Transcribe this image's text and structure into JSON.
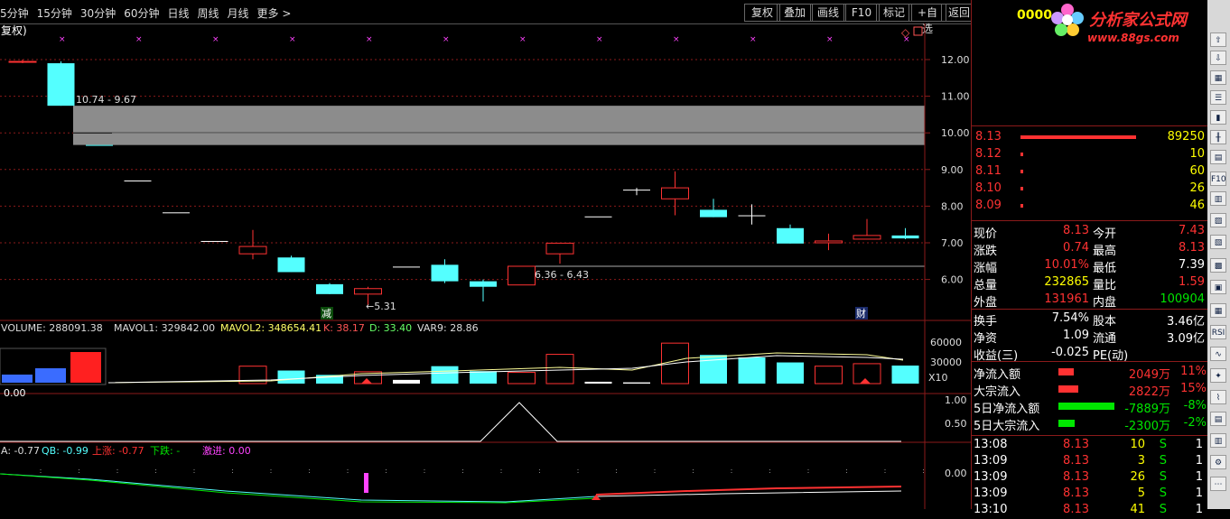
{
  "toolbar": {
    "periods": [
      "5分钟",
      "15分钟",
      "30分钟",
      "60分钟",
      "日线",
      "周线",
      "月线",
      "更多 >"
    ],
    "buttons": [
      "复权",
      "叠加",
      "画线",
      "F10",
      "标记",
      "+自选",
      "返回"
    ]
  },
  "main_chart": {
    "label": "复权)",
    "price_ticks": [
      "12.00",
      "11.00",
      "10.00",
      "9.00",
      "8.00",
      "7.00",
      "6.00"
    ],
    "gap_labels": [
      "10.74 - 9.67",
      "6.36 - 6.43"
    ],
    "low_label": "←5.31",
    "markers": [
      "减",
      "财"
    ],
    "candles": [
      {
        "o": 11.95,
        "h": 12.0,
        "l": 11.9,
        "c": 11.93,
        "col": "red"
      },
      {
        "o": 11.9,
        "h": 11.95,
        "l": 10.74,
        "c": 10.74,
        "col": "cyan"
      },
      {
        "o": 9.67,
        "h": 9.67,
        "l": 9.67,
        "c": 9.67,
        "col": "cyan"
      },
      {
        "o": 8.7,
        "h": 8.7,
        "l": 8.7,
        "c": 8.7,
        "col": "white"
      },
      {
        "o": 7.83,
        "h": 7.83,
        "l": 7.83,
        "c": 7.83,
        "col": "white"
      },
      {
        "o": 7.05,
        "h": 7.05,
        "l": 7.05,
        "c": 7.05,
        "col": "white"
      },
      {
        "o": 6.7,
        "h": 7.35,
        "l": 6.55,
        "c": 6.9,
        "col": "red"
      },
      {
        "o": 6.6,
        "h": 6.65,
        "l": 6.2,
        "c": 6.2,
        "col": "cyan"
      },
      {
        "o": 5.87,
        "h": 5.9,
        "l": 5.6,
        "c": 5.6,
        "col": "cyan"
      },
      {
        "o": 5.6,
        "h": 5.8,
        "l": 5.31,
        "c": 5.75,
        "col": "red"
      },
      {
        "o": 6.35,
        "h": 6.35,
        "l": 6.35,
        "c": 6.35,
        "col": "white"
      },
      {
        "o": 6.4,
        "h": 6.55,
        "l": 5.9,
        "c": 5.95,
        "col": "cyan"
      },
      {
        "o": 5.95,
        "h": 6.0,
        "l": 5.4,
        "c": 5.8,
        "col": "cyan"
      },
      {
        "o": 5.85,
        "h": 6.36,
        "l": 5.85,
        "c": 6.36,
        "col": "red"
      },
      {
        "o": 6.7,
        "h": 7.0,
        "l": 6.43,
        "c": 6.99,
        "col": "red"
      },
      {
        "o": 7.72,
        "h": 7.72,
        "l": 7.72,
        "c": 7.72,
        "col": "white"
      },
      {
        "o": 8.45,
        "h": 8.5,
        "l": 8.3,
        "c": 8.45,
        "col": "white"
      },
      {
        "o": 8.2,
        "h": 8.95,
        "l": 7.75,
        "c": 8.5,
        "col": "red"
      },
      {
        "o": 7.9,
        "h": 8.2,
        "l": 7.7,
        "c": 7.7,
        "col": "cyan"
      },
      {
        "o": 7.75,
        "h": 8.05,
        "l": 7.5,
        "c": 7.75,
        "col": "white"
      },
      {
        "o": 7.4,
        "h": 7.5,
        "l": 6.98,
        "c": 6.98,
        "col": "cyan"
      },
      {
        "o": 7.0,
        "h": 7.25,
        "l": 6.8,
        "c": 7.05,
        "col": "red"
      },
      {
        "o": 7.1,
        "h": 7.65,
        "l": 7.1,
        "c": 7.2,
        "col": "red"
      },
      {
        "o": 7.2,
        "h": 7.4,
        "l": 7.1,
        "c": 7.12,
        "col": "cyan"
      }
    ]
  },
  "volume_panel": {
    "volume_label": "VOLUME: 288091.38",
    "mavol1_label": "MAVOL1: 329842.00",
    "mavol2_label": "MAVOL2: 348654.41",
    "k_label": "K: 38.17",
    "d_label": "D: 33.40",
    "var9_label": "VAR9: 28.86",
    "ticks": [
      "60000",
      "30000"
    ],
    "unit": "X10",
    "bars": [
      {
        "v": 0,
        "col": "red"
      },
      {
        "v": 0,
        "col": "cyan"
      },
      {
        "v": 0,
        "col": "cyan"
      },
      {
        "v": 0,
        "col": "white"
      },
      {
        "v": 0,
        "col": "white"
      },
      {
        "v": 0,
        "col": "white"
      },
      {
        "v": 28000,
        "col": "red"
      },
      {
        "v": 21000,
        "col": "cyan"
      },
      {
        "v": 14000,
        "col": "cyan"
      },
      {
        "v": 19000,
        "col": "red"
      },
      {
        "v": 6000,
        "col": "white"
      },
      {
        "v": 28000,
        "col": "cyan"
      },
      {
        "v": 20000,
        "col": "cyan"
      },
      {
        "v": 18000,
        "col": "red"
      },
      {
        "v": 47000,
        "col": "red"
      },
      {
        "v": 3000,
        "col": "white"
      },
      {
        "v": 2000,
        "col": "white"
      },
      {
        "v": 65000,
        "col": "red"
      },
      {
        "v": 46000,
        "col": "cyan"
      },
      {
        "v": 42000,
        "col": "cyan"
      },
      {
        "v": 34000,
        "col": "cyan"
      },
      {
        "v": 28000,
        "col": "red"
      },
      {
        "v": 32000,
        "col": "red"
      },
      {
        "v": 29000,
        "col": "cyan"
      }
    ]
  },
  "kdj_panel": {
    "current": "0.00",
    "ticks": [
      "1.00",
      "0.50"
    ]
  },
  "flow_panel": {
    "a_label": "A: -0.77",
    "qb_label": "QB: -0.99",
    "up_label": "上涨: -0.77",
    "down_label": "下跌: -",
    "jj_label": "激进: 0.00",
    "tick": "0.00"
  },
  "quote": {
    "code": "0000",
    "watermark_name": "分析家公式网",
    "watermark_url": "www.88gs.com",
    "order_book": [
      {
        "price": "8.13",
        "vol": "89250",
        "bar": 128
      },
      {
        "price": "8.12",
        "vol": "10",
        "bar": 3
      },
      {
        "price": "8.11",
        "vol": "60",
        "bar": 3
      },
      {
        "price": "8.10",
        "vol": "26",
        "bar": 3
      },
      {
        "price": "8.09",
        "vol": "46",
        "bar": 3
      }
    ],
    "stats": [
      {
        "l1": "现价",
        "v1": "8.13",
        "c1": "red",
        "l2": "今开",
        "v2": "7.43",
        "c2": "red"
      },
      {
        "l1": "涨跌",
        "v1": "0.74",
        "c1": "red",
        "l2": "最高",
        "v2": "8.13",
        "c2": "red"
      },
      {
        "l1": "涨幅",
        "v1": "10.01%",
        "c1": "red",
        "l2": "最低",
        "v2": "7.39",
        "c2": "white"
      },
      {
        "l1": "总量",
        "v1": "232865",
        "c1": "yellow",
        "l2": "量比",
        "v2": "1.59",
        "c2": "red"
      },
      {
        "l1": "外盘",
        "v1": "131961",
        "c1": "red",
        "l2": "内盘",
        "v2": "100904",
        "c2": "green"
      }
    ],
    "stats2": [
      {
        "l1": "换手",
        "v1": "7.54%",
        "l2": "股本",
        "v2": "3.46亿"
      },
      {
        "l1": "净资",
        "v1": "1.09",
        "l2": "流通",
        "v2": "3.09亿"
      },
      {
        "l1": "收益(三)",
        "v1": "-0.025",
        "l2": "PE(动)",
        "v2": ""
      }
    ],
    "flows": [
      {
        "label": "净流入额",
        "val": "2049万",
        "pct": "11%",
        "col": "red",
        "bar": 17
      },
      {
        "label": "大宗流入",
        "val": "2822万",
        "pct": "15%",
        "col": "red",
        "bar": 22
      },
      {
        "label": "5日净流入额",
        "val": "-7889万",
        "pct": "-8%",
        "col": "green",
        "bar": 62
      },
      {
        "label": "5日大宗流入",
        "val": "-2300万",
        "pct": "-2%",
        "col": "green",
        "bar": 18
      }
    ],
    "ticks": [
      {
        "time": "13:08",
        "price": "8.13",
        "vol": "10",
        "bs": "S",
        "n": "1"
      },
      {
        "time": "13:09",
        "price": "8.13",
        "vol": "3",
        "bs": "S",
        "n": "1"
      },
      {
        "time": "13:09",
        "price": "8.13",
        "vol": "26",
        "bs": "S",
        "n": "1"
      },
      {
        "time": "13:09",
        "price": "8.13",
        "vol": "5",
        "bs": "S",
        "n": "1"
      },
      {
        "time": "13:10",
        "price": "8.13",
        "vol": "41",
        "bs": "S",
        "n": "1"
      }
    ],
    "side_icons": [
      "RSI",
      "F10"
    ]
  }
}
